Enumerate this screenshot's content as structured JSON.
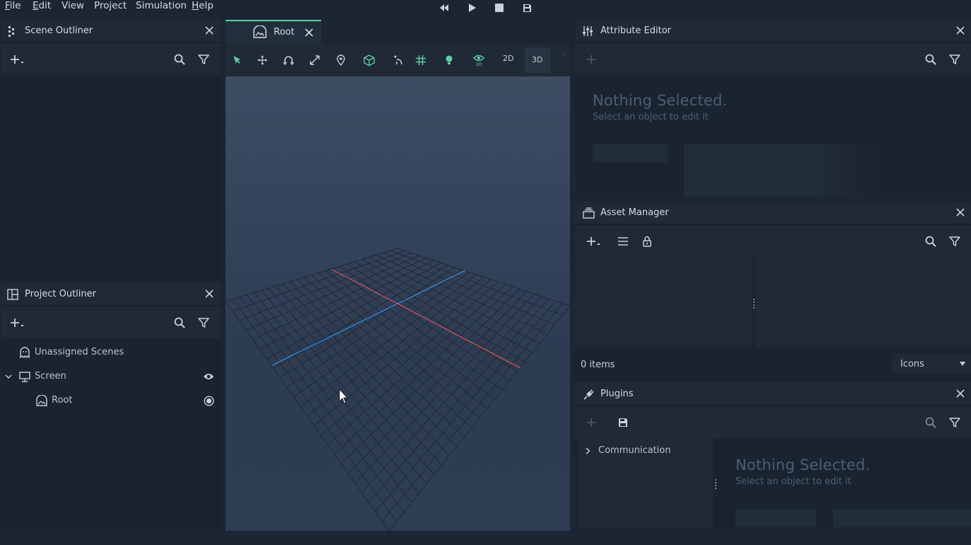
{
  "menu": {
    "items": [
      {
        "label": "File",
        "mnemonic": "F",
        "rest": "ile"
      },
      {
        "label": "Edit",
        "mnemonic": "E",
        "rest": "dit"
      },
      {
        "label": "View",
        "mnemonic": "",
        "rest": "View"
      },
      {
        "label": "Project",
        "mnemonic": "",
        "rest": "Project"
      },
      {
        "label": "Simulation",
        "mnemonic": "",
        "rest": "Simulation"
      },
      {
        "label": "Help",
        "mnemonic": "H",
        "rest": "elp"
      }
    ]
  },
  "scene_outliner": {
    "title": "Scene Outliner"
  },
  "project_outliner": {
    "title": "Project Outliner",
    "items": [
      {
        "label": "Unassigned Scenes"
      },
      {
        "label": "Screen"
      },
      {
        "label": "Root"
      }
    ]
  },
  "viewport": {
    "tab_label": "Root",
    "mode_2d": "2D",
    "mode_3d": "3D"
  },
  "attribute_editor": {
    "title": "Attribute Editor",
    "empty_title": "Nothing Selected.",
    "empty_subtitle": "Select an object to edit it"
  },
  "asset_manager": {
    "title": "Asset Manager",
    "item_count": "0 items",
    "view_mode": "Icons"
  },
  "plugins": {
    "title": "Plugins",
    "tree_items": [
      {
        "label": "Communication"
      }
    ],
    "empty_title": "Nothing Selected.",
    "empty_subtitle": "Select an object to edit it"
  },
  "colors": {
    "accent": "#5fd0a6",
    "axis_x": "#e0525c",
    "axis_z": "#3a8fe0",
    "panel_bg": "#1a2430"
  }
}
